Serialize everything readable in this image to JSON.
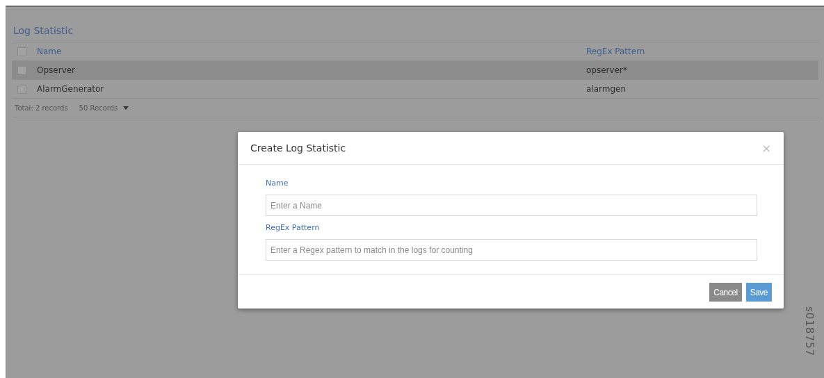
{
  "page": {
    "title": "Log Statistic"
  },
  "table": {
    "select_all": {
      "checked": false
    },
    "columns": [
      "Name",
      "RegEx Pattern"
    ],
    "rows": [
      {
        "checked": false,
        "selected": true,
        "cells": [
          "Opserver",
          "opserver*"
        ]
      },
      {
        "checked": false,
        "selected": false,
        "cells": [
          "AlarmGenerator",
          "alarmgen"
        ]
      }
    ]
  },
  "footer": {
    "total": "Total: 2 records",
    "page_size": "50 Records"
  },
  "dialog": {
    "title": "Create Log Statistic",
    "close": "×",
    "fields": [
      {
        "label": "Name",
        "placeholder": "Enter a Name"
      },
      {
        "label": "RegEx Pattern",
        "placeholder": "Enter a Regex pattern to match in the logs for counting"
      }
    ],
    "buttons": [
      {
        "label": "Cancel",
        "kind": "secondary"
      },
      {
        "label": "Save",
        "kind": "primary"
      }
    ]
  },
  "figure_id": "s018757"
}
